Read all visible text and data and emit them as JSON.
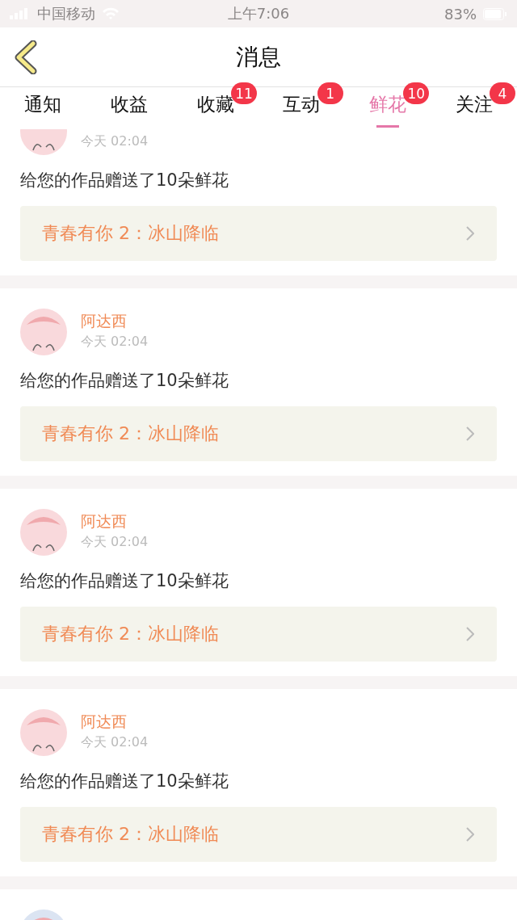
{
  "status_bar": {
    "carrier": "中国移动",
    "time": "上午7:06",
    "battery": "83%"
  },
  "nav": {
    "title": "消息"
  },
  "tabs": [
    {
      "label": "通知",
      "selected": false
    },
    {
      "label": "收益",
      "selected": false
    },
    {
      "label": "收藏",
      "selected": false,
      "badge": "11"
    },
    {
      "label": "互动",
      "selected": false,
      "badge": "1"
    },
    {
      "label": "鲜花",
      "selected": true,
      "badge": "10"
    },
    {
      "label": "关注",
      "selected": false,
      "badge": "4"
    }
  ],
  "messages": [
    {
      "color": "#f9d9dc",
      "time": "今天 02:04",
      "text": "给您的作品赠送了10朵鲜花",
      "work": "青春有你 2：冰山降临"
    },
    {
      "color": "#f9d9dc",
      "name": "阿达西",
      "time": "今天 02:04",
      "text": "给您的作品赠送了10朵鲜花",
      "work": "青春有你 2：冰山降临"
    },
    {
      "color": "#f9d9dc",
      "name": "阿达西",
      "time": "今天 02:04",
      "text": "给您的作品赠送了10朵鲜花",
      "work": "青春有你 2：冰山降临"
    },
    {
      "color": "#f9d9dc",
      "name": "阿达西",
      "time": "今天 02:04",
      "text": "给您的作品赠送了10朵鲜花",
      "work": "青春有你 2：冰山降临"
    },
    {
      "color": "#dbe4f2"
    }
  ]
}
